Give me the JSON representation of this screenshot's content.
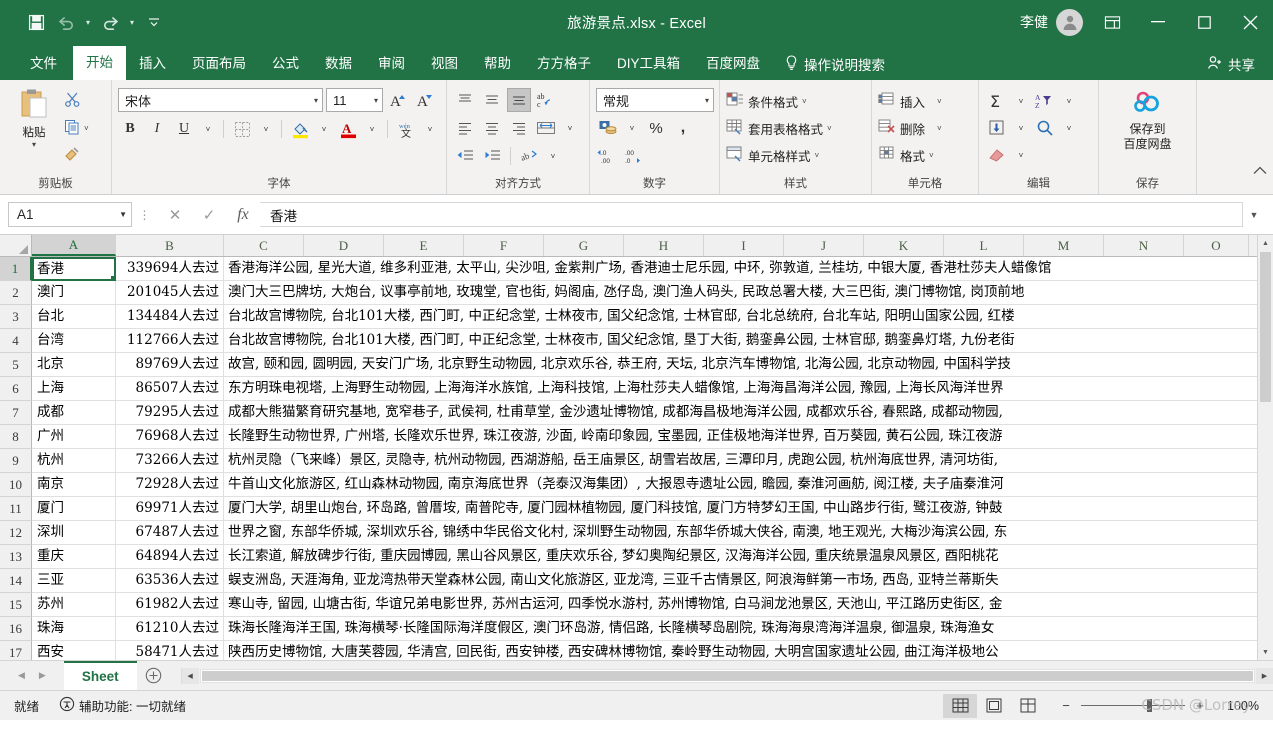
{
  "titlebar": {
    "filename": "旅游景点.xlsx  -  Excel",
    "user": "李健",
    "qat": [
      {
        "name": "save-icon",
        "label": "保存"
      },
      {
        "name": "undo-icon",
        "label": "撤消"
      },
      {
        "name": "redo-icon",
        "label": "恢复"
      },
      {
        "name": "customize-qat-icon",
        "label": "自定义快速访问工具栏"
      }
    ],
    "ribbon_display_label": "功能区显示选项",
    "minimize_label": "最小化",
    "maximize_label": "最大化",
    "close_label": "关闭"
  },
  "tabs": [
    {
      "label": "文件",
      "active": false
    },
    {
      "label": "开始",
      "active": true
    },
    {
      "label": "插入",
      "active": false
    },
    {
      "label": "页面布局",
      "active": false
    },
    {
      "label": "公式",
      "active": false
    },
    {
      "label": "数据",
      "active": false
    },
    {
      "label": "审阅",
      "active": false
    },
    {
      "label": "视图",
      "active": false
    },
    {
      "label": "帮助",
      "active": false
    },
    {
      "label": "方方格子",
      "active": false
    },
    {
      "label": "DIY工具箱",
      "active": false
    },
    {
      "label": "百度网盘",
      "active": false
    }
  ],
  "tell_me": "操作说明搜索",
  "share": "共享",
  "ribbon": {
    "clipboard": {
      "title": "剪贴板",
      "paste": "粘贴",
      "cut": "剪切",
      "copy": "复制",
      "format_painter": "格式刷"
    },
    "font": {
      "title": "字体",
      "font_name": "宋体",
      "font_size": "11",
      "grow_font": "增大字号",
      "shrink_font": "减小字号",
      "bold": "B",
      "italic": "I",
      "underline": "U",
      "borders": "边框",
      "fill_color": "填充颜色",
      "font_color": "字体颜色",
      "phonetic": "拼音指南"
    },
    "alignment": {
      "title": "对齐方式",
      "align_top": "顶端对齐",
      "align_middle": "垂直居中",
      "align_bottom": "底端对齐",
      "orientation": "方向",
      "align_left": "左对齐",
      "align_center": "居中",
      "align_right": "右对齐",
      "wrap_text": "自动换行",
      "merge_center": "合并后居中",
      "decrease_indent": "减少缩进量",
      "increase_indent": "增加缩进量"
    },
    "number": {
      "title": "数字",
      "format": "常规",
      "accounting": "会计数字格式",
      "percent": "%",
      "comma": ",",
      "increase_decimal": "增加小数位数",
      "decrease_decimal": "减少小数位数"
    },
    "styles": {
      "title": "样式",
      "items": [
        "条件格式",
        "套用表格格式",
        "单元格样式"
      ]
    },
    "cells": {
      "title": "单元格",
      "items": [
        "插入",
        "删除",
        "格式"
      ]
    },
    "editing": {
      "title": "编辑",
      "autosum": "自动求和",
      "fill": "填充",
      "clear": "清除",
      "sort_filter": "排序和筛选",
      "find_select": "查找和选择"
    },
    "save": {
      "title": "保存",
      "label_line1": "保存到",
      "label_line2": "百度网盘"
    }
  },
  "formula_bar": {
    "name_box": "A1",
    "cancel": "取消",
    "enter": "输入",
    "insert_function": "fx",
    "value": "香港"
  },
  "grid": {
    "columns": [
      "A",
      "B",
      "C",
      "D",
      "E",
      "F",
      "G",
      "H",
      "I",
      "J",
      "K",
      "L",
      "M",
      "N",
      "O"
    ],
    "selected_column": "A",
    "selected_row": 1,
    "rows": [
      {
        "n": 1,
        "a": "香港",
        "b": "339694人去过",
        "c": "香港海洋公园, 星光大道, 维多利亚港, 太平山, 尖沙咀, 金紫荆广场, 香港迪士尼乐园, 中环, 弥敦道, 兰桂坊, 中银大厦, 香港杜莎夫人蜡像馆"
      },
      {
        "n": 2,
        "a": "澳门",
        "b": "201045人去过",
        "c": "澳门大三巴牌坊, 大炮台, 议事亭前地, 玫瑰堂, 官也街, 妈阁庙, 氹仔岛, 澳门渔人码头, 民政总署大楼, 大三巴街, 澳门博物馆, 岗顶前地"
      },
      {
        "n": 3,
        "a": "台北",
        "b": "134484人去过",
        "c": "台北故宫博物院, 台北101大楼, 西门町, 中正纪念堂, 士林夜市, 国父纪念馆, 士林官邸, 台北总统府, 台北车站, 阳明山国家公园, 红楼"
      },
      {
        "n": 4,
        "a": "台湾",
        "b": "112766人去过",
        "c": "台北故宫博物院, 台北101大楼, 西门町, 中正纪念堂, 士林夜市, 国父纪念馆, 垦丁大街, 鹅銮鼻公园, 士林官邸, 鹅銮鼻灯塔, 九份老街"
      },
      {
        "n": 5,
        "a": "北京",
        "b": "89769人去过",
        "c": "故宫, 颐和园, 圆明园, 天安门广场, 北京野生动物园, 北京欢乐谷, 恭王府, 天坛, 北京汽车博物馆, 北海公园, 北京动物园, 中国科学技"
      },
      {
        "n": 6,
        "a": "上海",
        "b": "86507人去过",
        "c": "东方明珠电视塔, 上海野生动物园, 上海海洋水族馆, 上海科技馆, 上海杜莎夫人蜡像馆, 上海海昌海洋公园, 豫园, 上海长风海洋世界"
      },
      {
        "n": 7,
        "a": "成都",
        "b": "79295人去过",
        "c": "成都大熊猫繁育研究基地, 宽窄巷子, 武侯祠, 杜甫草堂, 金沙遗址博物馆, 成都海昌极地海洋公园, 成都欢乐谷, 春熙路, 成都动物园,"
      },
      {
        "n": 8,
        "a": "广州",
        "b": "76968人去过",
        "c": "长隆野生动物世界, 广州塔, 长隆欢乐世界, 珠江夜游, 沙面, 岭南印象园, 宝墨园, 正佳极地海洋世界, 百万葵园, 黄石公园, 珠江夜游"
      },
      {
        "n": 9,
        "a": "杭州",
        "b": "73266人去过",
        "c": "杭州灵隐（飞来峰）景区, 灵隐寺, 杭州动物园, 西湖游船, 岳王庙景区, 胡雪岩故居, 三潭印月, 虎跑公园, 杭州海底世界, 清河坊街,"
      },
      {
        "n": 10,
        "a": "南京",
        "b": "72928人去过",
        "c": "牛首山文化旅游区, 红山森林动物园, 南京海底世界（尧泰汉海集团）, 大报恩寺遗址公园, 瞻园, 秦淮河画舫, 阅江楼, 夫子庙秦淮河"
      },
      {
        "n": 11,
        "a": "厦门",
        "b": "69971人去过",
        "c": "厦门大学, 胡里山炮台, 环岛路, 曾厝垵, 南普陀寺, 厦门园林植物园, 厦门科技馆, 厦门方特梦幻王国, 中山路步行街, 鹭江夜游, 钟鼓"
      },
      {
        "n": 12,
        "a": "深圳",
        "b": "67487人去过",
        "c": "世界之窗, 东部华侨城, 深圳欢乐谷, 锦绣中华民俗文化村, 深圳野生动物园, 东部华侨城大侠谷, 南澳, 地王观光, 大梅沙海滨公园, 东"
      },
      {
        "n": 13,
        "a": "重庆",
        "b": "64894人去过",
        "c": "长江索道, 解放碑步行街, 重庆园博园, 黑山谷风景区, 重庆欢乐谷, 梦幻奥陶纪景区, 汉海海洋公园, 重庆统景温泉风景区, 酉阳桃花"
      },
      {
        "n": 14,
        "a": "三亚",
        "b": "63536人去过",
        "c": "蜈支洲岛, 天涯海角, 亚龙湾热带天堂森林公园, 南山文化旅游区, 亚龙湾, 三亚千古情景区, 阿浪海鲜第一市场, 西岛, 亚特兰蒂斯失"
      },
      {
        "n": 15,
        "a": "苏州",
        "b": "61982人去过",
        "c": "寒山寺, 留园, 山塘古街, 华谊兄弟电影世界, 苏州古运河, 四季悦水游村, 苏州博物馆, 白马涧龙池景区, 天池山, 平江路历史街区, 金"
      },
      {
        "n": 16,
        "a": "珠海",
        "b": "61210人去过",
        "c": "珠海长隆海洋王国, 珠海横琴·长隆国际海洋度假区, 澳门环岛游, 情侣路, 长隆横琴岛剧院, 珠海海泉湾海洋温泉, 御温泉, 珠海渔女"
      },
      {
        "n": 17,
        "a": "西安",
        "b": "58471人去过",
        "c": "陕西历史博物馆, 大唐芙蓉园, 华清宫, 回民街, 西安钟楼, 西安碑林博物馆, 秦岭野生动物园, 大明宫国家遗址公园, 曲江海洋极地公"
      }
    ]
  },
  "sheetbar": {
    "prev": "上一张工作表",
    "next": "下一张工作表",
    "tab": "Sheet",
    "add": "新建工作表"
  },
  "statusbar": {
    "ready": "就绪",
    "accessibility": "辅助功能: 一切就绪",
    "view_normal": "普通",
    "view_pagelayout": "页面布局",
    "view_pagebreak": "分页预览",
    "zoom_out": "缩小",
    "zoom_in": "放大",
    "zoom_value": "100%"
  },
  "watermark": "CSDN @Lorrey",
  "colors": {
    "brand_green": "#217346",
    "ribbon_bg": "#f3f2f1",
    "grid_line": "#e0e0e0"
  }
}
